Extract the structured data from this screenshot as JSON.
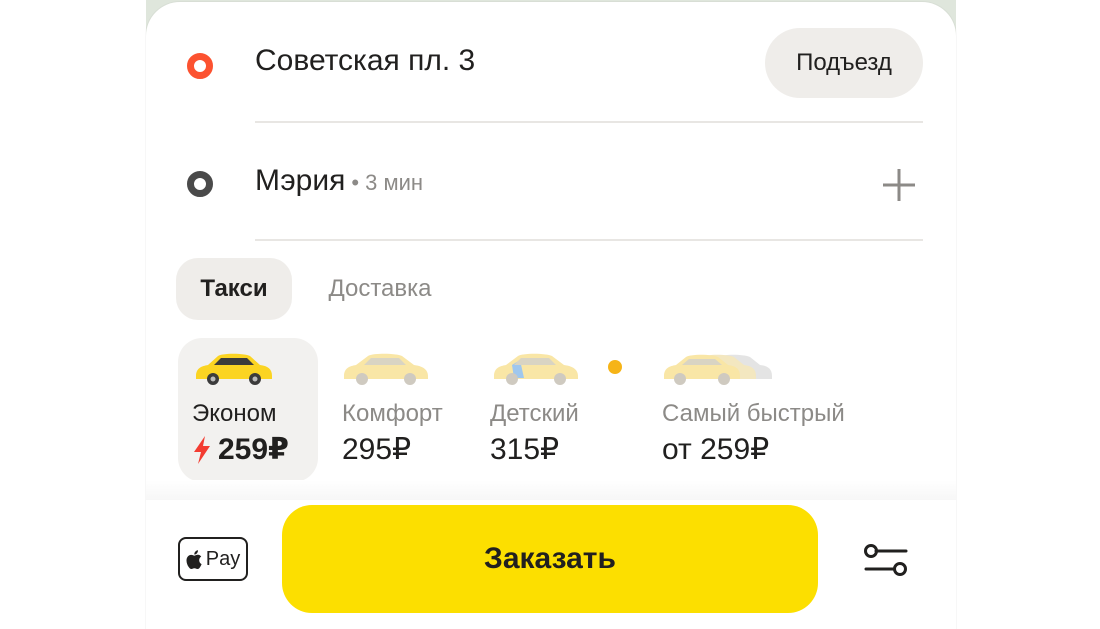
{
  "route": {
    "from": {
      "address": "Советская пл. 3",
      "entrance_label": "Подъезд"
    },
    "to": {
      "address": "Мэрия",
      "eta": "• 3 мин"
    }
  },
  "tabs": [
    {
      "label": "Такси",
      "active": true
    },
    {
      "label": "Доставка",
      "active": false
    }
  ],
  "tariffs": [
    {
      "name": "Эконом",
      "price": "259₽",
      "selected": true,
      "surge": true
    },
    {
      "name": "Комфорт",
      "price": "295₽",
      "selected": false
    },
    {
      "name": "Детский",
      "price": "315₽",
      "selected": false,
      "promo_dot": true
    },
    {
      "name": "Самый быстрый",
      "price": "от 259₽",
      "selected": false
    }
  ],
  "payment": {
    "method": "Apple Pay",
    "pay_text": "Pay"
  },
  "actions": {
    "order_label": "Заказать"
  },
  "colors": {
    "accent_yellow": "#fcdf00",
    "origin_dot": "#fc5230",
    "surge_red": "#f33c31",
    "promo_dot": "#f6b417"
  },
  "icons": [
    "origin-marker-icon",
    "destination-marker-icon",
    "plus-icon",
    "car-icon",
    "lightning-icon",
    "apple-logo-icon",
    "settings-sliders-icon"
  ]
}
